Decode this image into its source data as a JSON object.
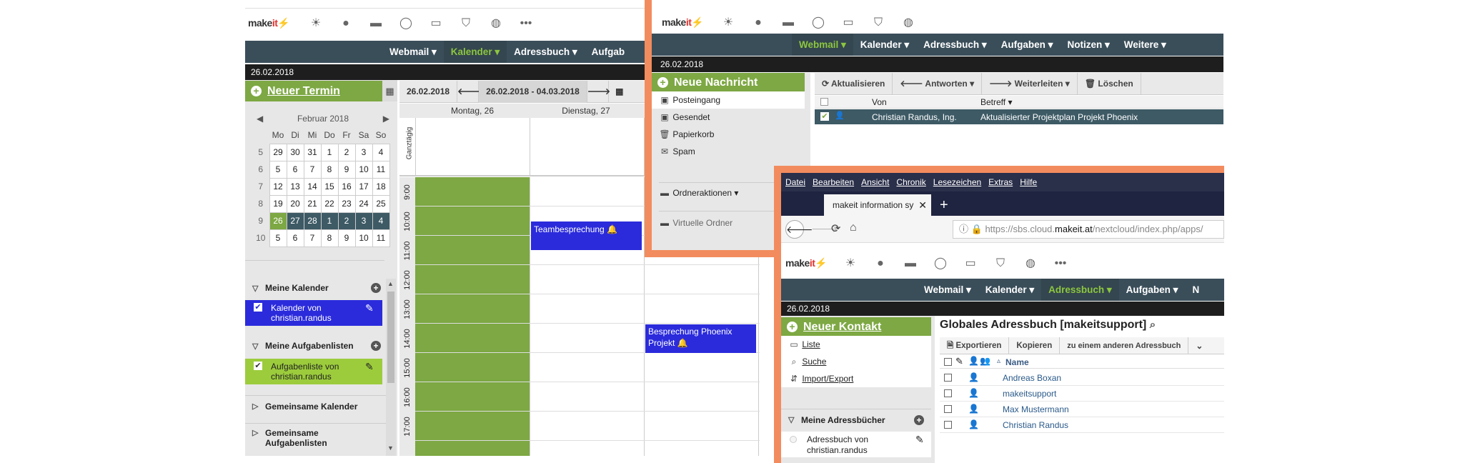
{
  "left": {
    "logo": {
      "pre": "make",
      "mid": "it"
    },
    "icons": [
      "sun-icon",
      "globe-icon",
      "folder-icon",
      "chat-icon",
      "drive-icon",
      "shield-icon",
      "earth-icon",
      "more-icon"
    ],
    "icon_glyphs": [
      "☀",
      "●",
      "▬",
      "◯",
      "▭",
      "⛉",
      "◍",
      "•••"
    ],
    "nav": [
      "Webmail ▾",
      "Kalender ▾",
      "Adressbuch ▾",
      "Aufgab"
    ],
    "date": "26.02.2018",
    "new_event": "Neuer Termin",
    "date_field": "26.02.2018",
    "range": "26.02.2018 - 04.03.2018",
    "mini_cal": {
      "title": "Februar 2018",
      "headers": [
        "Mo",
        "Di",
        "Mi",
        "Do",
        "Fr",
        "Sa",
        "So"
      ],
      "rows": [
        {
          "wk": "5",
          "d": [
            "29",
            "30",
            "31",
            "1",
            "2",
            "3",
            "4"
          ]
        },
        {
          "wk": "6",
          "d": [
            "5",
            "6",
            "7",
            "8",
            "9",
            "10",
            "11"
          ]
        },
        {
          "wk": "7",
          "d": [
            "12",
            "13",
            "14",
            "15",
            "16",
            "17",
            "18"
          ]
        },
        {
          "wk": "8",
          "d": [
            "19",
            "20",
            "21",
            "22",
            "23",
            "24",
            "25"
          ]
        },
        {
          "wk": "9",
          "d": [
            "26",
            "27",
            "28",
            "1",
            "2",
            "3",
            "4"
          ]
        },
        {
          "wk": "10",
          "d": [
            "5",
            "6",
            "7",
            "8",
            "9",
            "10",
            "11"
          ]
        }
      ]
    },
    "my_calendars": "Meine Kalender",
    "calendar_entry": "Kalender von christian.randus",
    "my_tasklists": "Meine Aufgabenlisten",
    "tasklist_entry": "Aufgabenliste von christian.randus",
    "shared_calendars": "Gemeinsame Kalender",
    "shared_tasklists": "Gemeinsame Aufgabenlisten",
    "day_headers": [
      "Montag, 26",
      "Dienstag, 27"
    ],
    "allday": "Ganztägig",
    "hours": [
      "9:00",
      "10:00",
      "11:00",
      "12:00",
      "13:00",
      "14:00",
      "15:00",
      "16:00",
      "17:00"
    ],
    "event1": "Teambesprechung 🔔",
    "event2": "Besprechung Phoenix Projekt 🔔"
  },
  "mid": {
    "logo": {
      "pre": "make",
      "mid": "it"
    },
    "nav": [
      "Webmail ▾",
      "Kalender ▾",
      "Adressbuch ▾",
      "Aufgaben ▾",
      "Notizen ▾",
      "Weitere ▾"
    ],
    "date": "26.02.2018",
    "new_message": "Neue Nachricht",
    "folders": [
      "Posteingang",
      "Gesendet",
      "Papierkorb",
      "Spam"
    ],
    "folder_actions": "Ordneraktionen",
    "virtual_folders": "Virtuelle Ordner",
    "toolbar": [
      "Aktualisieren",
      "Antworten",
      "Weiterleiten",
      "Löschen"
    ],
    "col_from": "Von",
    "col_subject": "Betreff",
    "row_from": "Christian Randus, Ing.",
    "row_subject": "Aktualisierter Projektplan Projekt Phoenix"
  },
  "right": {
    "menu": [
      "Datei",
      "Bearbeiten",
      "Ansicht",
      "Chronik",
      "Lesezeichen",
      "Extras",
      "Hilfe"
    ],
    "tab_title": "makeit information sy",
    "url_prefix": "https://sbs.cloud.",
    "url_domain": "makeit.at",
    "url_suffix": "/nextcloud/index.php/apps/",
    "logo": {
      "pre": "make",
      "mid": "it"
    },
    "nav": [
      "Webmail ▾",
      "Kalender ▾",
      "Adressbuch ▾",
      "Aufgaben ▾",
      "N"
    ],
    "date": "26.02.2018",
    "new_contact": "Neuer Kontakt",
    "side_items": [
      "Liste",
      "Suche",
      "Import/Export"
    ],
    "my_books": "Meine Adressbücher",
    "book_entry": "Adressbuch von christian.randus",
    "title": "Globales Adressbuch [makeitsupport]",
    "toolbar": [
      "Exportieren",
      "Kopieren",
      "zu einem anderen Adressbuch"
    ],
    "col_name": "Name",
    "contacts": [
      "Andreas Boxan",
      "makeitsupport",
      "Max Mustermann",
      "Christian Randus"
    ]
  },
  "colors": {
    "nav": "#3a4e5a",
    "green": "#7da843",
    "orange": "#f28c5e",
    "event": "#2b2bdc"
  }
}
